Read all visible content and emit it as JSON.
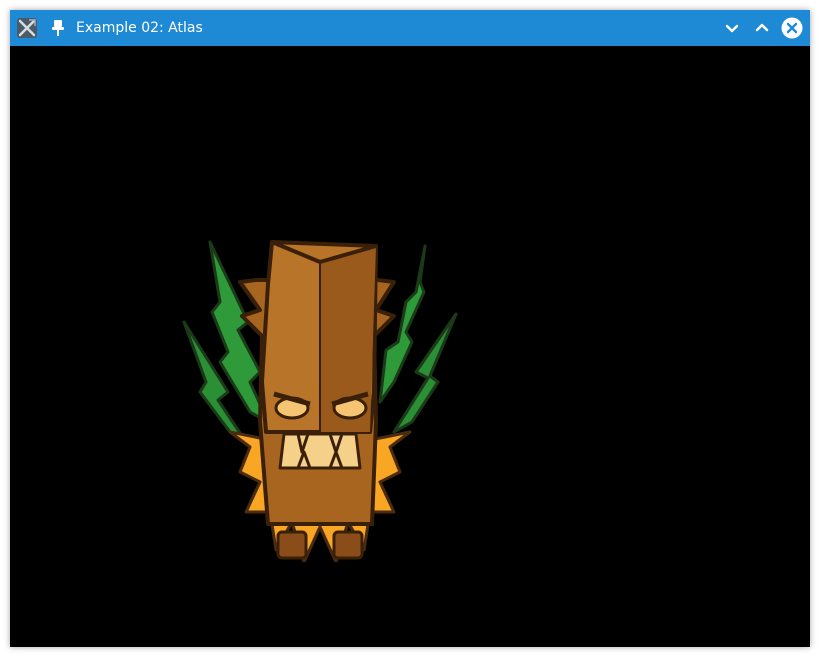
{
  "window": {
    "title": "Example 02: Atlas",
    "accent_color": "#1e8ad6",
    "background_color": "#000000"
  },
  "titlebar": {
    "app_icon": "app-icon",
    "pin_icon": "pin-icon",
    "buttons": [
      {
        "name": "minimize",
        "icon": "chevron-down-icon"
      },
      {
        "name": "maximize",
        "icon": "chevron-up-icon"
      },
      {
        "name": "close",
        "icon": "close-icon"
      }
    ]
  },
  "canvas": {
    "sprite": "tiki-mask"
  }
}
